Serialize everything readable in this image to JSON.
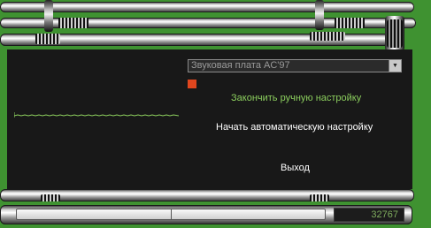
{
  "device_select": {
    "value": "Звуковая плата AC'97"
  },
  "actions": {
    "finish_manual": "Закончить ручную настройку",
    "start_auto": "Начать автоматическую настройку",
    "exit": "Выход"
  },
  "counter": {
    "value": "32767"
  },
  "colors": {
    "background_green": "#3f9231",
    "panel": "#181818",
    "accent_green": "#8ccf5e",
    "indicator_red": "#e0461e",
    "text_white": "#ffffff"
  },
  "icons": {
    "dropdown": "chevron-down-icon",
    "indicator": "red-square-indicator"
  }
}
